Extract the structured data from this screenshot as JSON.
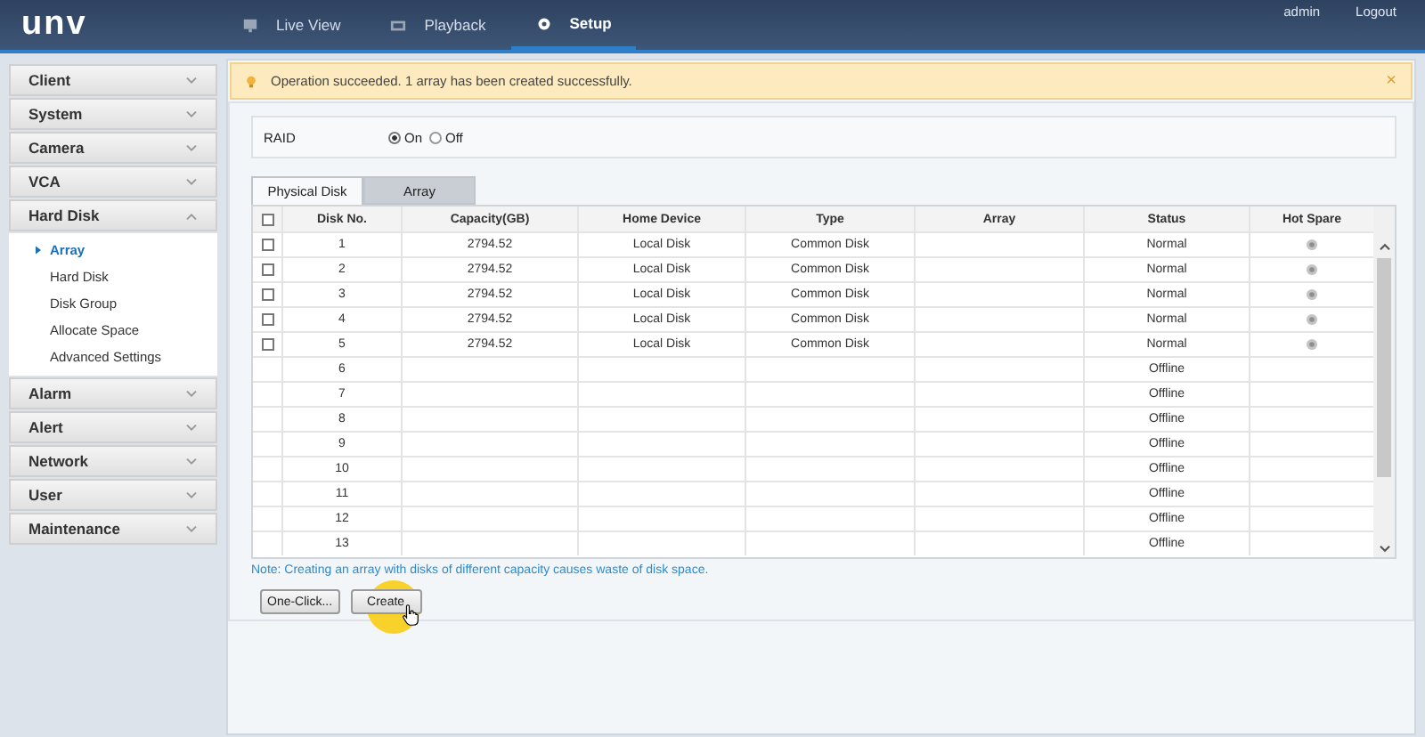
{
  "header": {
    "logo": "unv",
    "nav": [
      {
        "label": "Live View",
        "selected": false
      },
      {
        "label": "Playback",
        "selected": false
      },
      {
        "label": "Setup",
        "selected": true
      }
    ],
    "user": "admin",
    "logout": "Logout"
  },
  "sidebar": {
    "items": [
      {
        "label": "Client",
        "expanded": false
      },
      {
        "label": "System",
        "expanded": false
      },
      {
        "label": "Camera",
        "expanded": false
      },
      {
        "label": "VCA",
        "expanded": false
      },
      {
        "label": "Hard Disk",
        "expanded": true,
        "children": [
          {
            "label": "Array",
            "selected": true
          },
          {
            "label": "Hard Disk",
            "selected": false
          },
          {
            "label": "Disk Group",
            "selected": false
          },
          {
            "label": "Allocate Space",
            "selected": false
          },
          {
            "label": "Advanced Settings",
            "selected": false
          }
        ]
      },
      {
        "label": "Alarm",
        "expanded": false
      },
      {
        "label": "Alert",
        "expanded": false
      },
      {
        "label": "Network",
        "expanded": false
      },
      {
        "label": "User",
        "expanded": false
      },
      {
        "label": "Maintenance",
        "expanded": false
      }
    ]
  },
  "message": {
    "text": "Operation succeeded. 1 array has been created successfully.",
    "close": "×"
  },
  "raid": {
    "label": "RAID",
    "options": [
      {
        "label": "On",
        "selected": true
      },
      {
        "label": "Off",
        "selected": false
      }
    ]
  },
  "tabs": [
    {
      "label": "Physical Disk",
      "selected": true
    },
    {
      "label": "Array",
      "selected": false
    }
  ],
  "table": {
    "select_all": {
      "checked": false
    },
    "columns": [
      "Disk No.",
      "Capacity(GB)",
      "Home Device",
      "Type",
      "Array",
      "Status",
      "Hot Spare"
    ],
    "rows": [
      {
        "kind": "disk",
        "checked": false,
        "disk_no": "1",
        "capacity": "2794.52",
        "home_device": "Local Disk",
        "type": "Common Disk",
        "status": "Normal"
      },
      {
        "kind": "disk",
        "checked": false,
        "disk_no": "2",
        "capacity": "2794.52",
        "home_device": "Local Disk",
        "type": "Common Disk",
        "status": "Normal"
      },
      {
        "kind": "disk",
        "checked": false,
        "disk_no": "3",
        "capacity": "2794.52",
        "home_device": "Local Disk",
        "type": "Common Disk",
        "status": "Normal"
      },
      {
        "kind": "disk",
        "checked": false,
        "disk_no": "4",
        "capacity": "2794.52",
        "home_device": "Local Disk",
        "type": "Common Disk",
        "status": "Normal"
      },
      {
        "kind": "disk",
        "checked": false,
        "disk_no": "5",
        "capacity": "2794.52",
        "home_device": "Local Disk",
        "type": "Common Disk",
        "status": "Normal"
      },
      {
        "kind": "slot",
        "disk_no": "6",
        "status": "Offline"
      },
      {
        "kind": "slot",
        "disk_no": "7",
        "status": "Offline"
      },
      {
        "kind": "slot",
        "disk_no": "8",
        "status": "Offline"
      },
      {
        "kind": "slot",
        "disk_no": "9",
        "status": "Offline"
      },
      {
        "kind": "slot",
        "disk_no": "10",
        "status": "Offline"
      },
      {
        "kind": "slot",
        "disk_no": "11",
        "status": "Offline"
      },
      {
        "kind": "slot",
        "disk_no": "12",
        "status": "Offline"
      },
      {
        "kind": "slot",
        "disk_no": "13",
        "status": "Offline"
      }
    ]
  },
  "note": "Note: Creating an array with disks of different capacity causes waste of disk space.",
  "buttons": [
    "One-Click...",
    "Create"
  ]
}
